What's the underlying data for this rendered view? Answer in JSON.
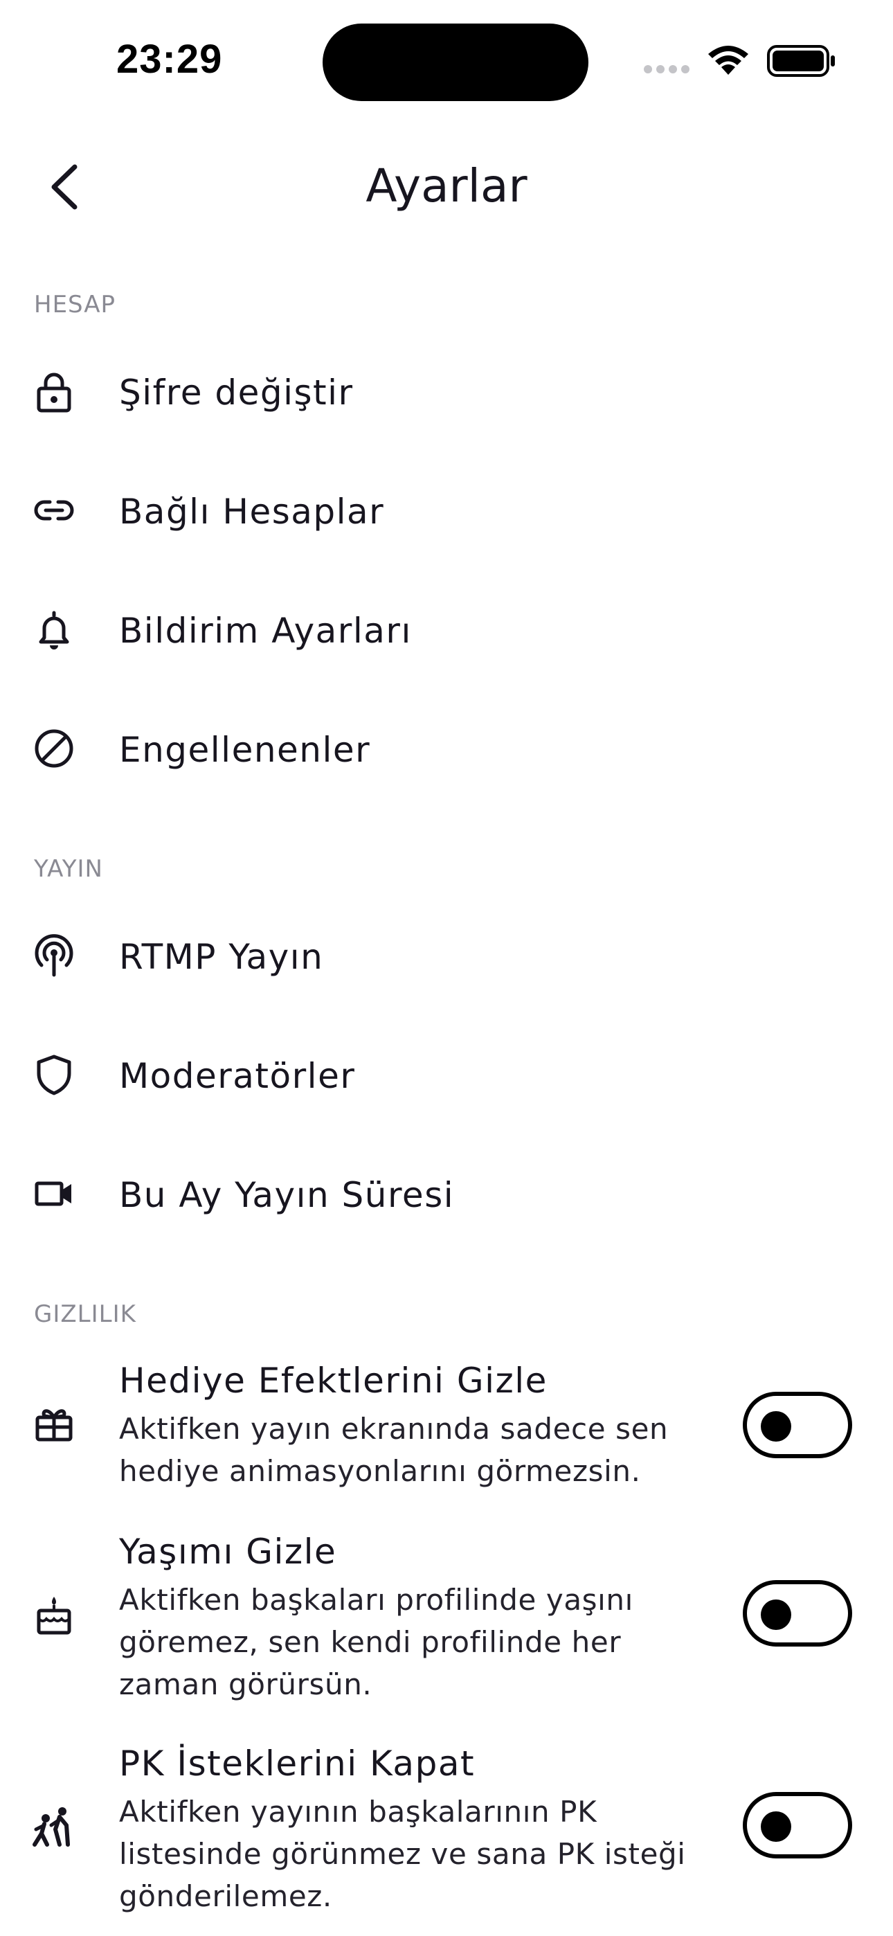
{
  "status_bar": {
    "time": "23:29"
  },
  "header": {
    "title": "Ayarlar",
    "back_icon": "chevron-left-icon"
  },
  "sections": {
    "account": {
      "header": "HESAP",
      "items": [
        {
          "label": "Şifre değiştir",
          "icon": "lock-icon"
        },
        {
          "label": "Bağlı Hesaplar",
          "icon": "link-icon"
        },
        {
          "label": "Bildirim Ayarları",
          "icon": "bell-icon"
        },
        {
          "label": "Engellenenler",
          "icon": "block-icon"
        }
      ]
    },
    "broadcast": {
      "header": "YAYIN",
      "items": [
        {
          "label": "RTMP Yayın",
          "icon": "broadcast-antenna-icon"
        },
        {
          "label": "Moderatörler",
          "icon": "shield-icon"
        },
        {
          "label": "Bu Ay Yayın Süresi",
          "icon": "video-camera-icon"
        }
      ]
    },
    "privacy": {
      "header": "GIZLILIK",
      "items": [
        {
          "title": "Hediye Efektlerini Gizle",
          "description": "Aktifken yayın ekranında sadece sen hediye animasyonlarını görmezsin.",
          "icon": "gift-icon",
          "enabled": false
        },
        {
          "title": "Yaşımı Gizle",
          "description": "Aktifken başkaları profilinde yaşını göremez, sen kendi profilinde her zaman görürsün.",
          "icon": "birthday-cake-icon",
          "enabled": false
        },
        {
          "title": "PK İsteklerini Kapat",
          "description": "Aktifken yayının başkalarının PK listesinde görünmez ve sana PK isteği gönderilemez.",
          "icon": "sports-kabaddi-icon",
          "enabled": false
        }
      ]
    }
  },
  "colors": {
    "text_primary": "#17151f",
    "section_header": "#8a8a93",
    "toggle_border": "#000000",
    "background": "#ffffff"
  }
}
